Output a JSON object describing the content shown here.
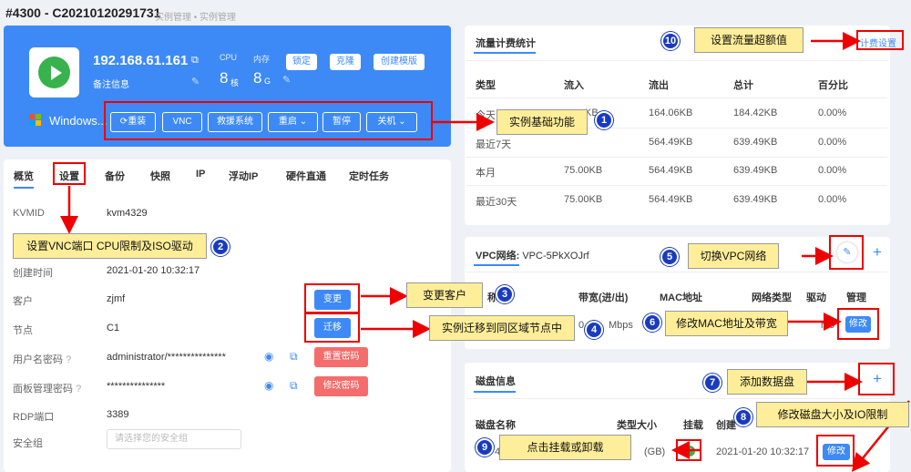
{
  "header": {
    "title": "#4300 - C20210120291731",
    "breadcrumb": "实例管理 • 实例管理"
  },
  "instance": {
    "ip": "192.168.61.161",
    "note": "备注信息",
    "cpu_label": "CPU",
    "cpu_value": "8",
    "cpu_unit": "核",
    "mem_label": "内存",
    "mem_value": "8",
    "mem_unit": "G",
    "os": "Windows...",
    "lock": "锁定",
    "clone": "克隆",
    "create_template": "创建模版"
  },
  "ops": [
    "重装",
    "VNC",
    "救援系统",
    "重启",
    "暂停",
    "关机"
  ],
  "tabs": [
    "概览",
    "设置",
    "备份",
    "快照",
    "IP",
    "浮动IP",
    "硬件直通",
    "定时任务"
  ],
  "info": {
    "kvmid_label": "KVMID",
    "kvmid": "kvm4329",
    "created_label": "创建时间",
    "created": "2021-01-20 10:32:17",
    "customer_label": "客户",
    "customer": "zjmf",
    "change": "变更",
    "node_label": "节点",
    "node": "C1",
    "migrate": "迁移",
    "user_pwd_label": "用户名密码",
    "user_pwd": "administrator/***************",
    "reset_pwd": "重置密码",
    "panel_pwd_label": "面板管理密码",
    "panel_pwd": "***************",
    "modify_pwd": "修改密码",
    "rdp_label": "RDP端口",
    "rdp": "3389",
    "sg_label": "安全组",
    "sg_placeholder": "请选择您的安全组"
  },
  "traffic": {
    "title": "流量计费统计",
    "settings": "计费设置",
    "headers": [
      "类型",
      "流入",
      "流出",
      "总计",
      "百分比"
    ],
    "rows": [
      [
        "今天",
        "KB",
        "164.06KB",
        "184.42KB",
        "0.00%"
      ],
      [
        "最近7天",
        "",
        "564.49KB",
        "639.49KB",
        "0.00%"
      ],
      [
        "本月",
        "75.00KB",
        "564.49KB",
        "639.49KB",
        "0.00%"
      ],
      [
        "最近30天",
        "75.00KB",
        "564.49KB",
        "639.49KB",
        "0.00%"
      ]
    ]
  },
  "vpc": {
    "title": "VPC网络:",
    "name": "VPC-5PkXOJrf",
    "headers": [
      "带宽(进/出)",
      "MAC地址",
      "网络类型",
      "驱动",
      "管理"
    ],
    "col1_frag": "称",
    "bw_frag": "0",
    "bw_frag2": "Mbps",
    "driver_frag": "rtio",
    "modify": "修改"
  },
  "disk": {
    "title": "磁盘信息",
    "headers": [
      "磁盘名称",
      "类型大小",
      "挂载",
      "创建"
    ],
    "disk_frag": "4",
    "type_frag": "(GB)",
    "created": "2021-01-20 10:32:17",
    "modify": "修改"
  },
  "callouts": {
    "c1": "实例基础功能",
    "c2": "设置VNC端口 CPU限制及ISO驱动",
    "c3": "变更客户",
    "c4": "实例迁移到同区域节点中",
    "c5": "切换VPC网络",
    "c6": "修改MAC地址及带宽",
    "c7": "添加数据盘",
    "c8": "修改磁盘大小及IO限制",
    "c9": "点击挂载或卸载",
    "c10": "设置流量超额值"
  },
  "numbers": [
    "1",
    "2",
    "3",
    "4",
    "5",
    "6",
    "7",
    "8",
    "9",
    "10"
  ]
}
